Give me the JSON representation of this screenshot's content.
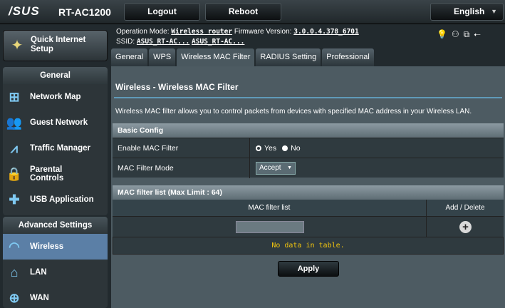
{
  "topbar": {
    "logo": "/SUS",
    "model": "RT-AC1200",
    "logout_label": "Logout",
    "reboot_label": "Reboot",
    "language": "English"
  },
  "sidebar": {
    "quick_setup": "Quick Internet Setup",
    "general_heading": "General",
    "general_items": [
      {
        "label": "Network Map",
        "icon": "network-map-icon"
      },
      {
        "label": "Guest Network",
        "icon": "guest-network-icon"
      },
      {
        "label": "Traffic Manager",
        "icon": "traffic-manager-icon"
      },
      {
        "label": "Parental Controls",
        "icon": "parental-controls-icon"
      },
      {
        "label": "USB Application",
        "icon": "usb-application-icon"
      }
    ],
    "advanced_heading": "Advanced Settings",
    "advanced_items": [
      {
        "label": "Wireless",
        "icon": "wireless-icon",
        "active": true
      },
      {
        "label": "LAN",
        "icon": "lan-icon"
      },
      {
        "label": "WAN",
        "icon": "wan-icon"
      }
    ]
  },
  "status": {
    "mode_label": "Operation Mode:",
    "mode_value": "Wireless router",
    "fw_label": "Firmware Version:",
    "fw_value": "3.0.0.4.378_6701",
    "ssid_label": "SSID:",
    "ssid_1": "ASUS_RT-AC...",
    "ssid_2": "ASUS_RT-AC..."
  },
  "tabs": [
    "General",
    "WPS",
    "Wireless MAC Filter",
    "RADIUS Setting",
    "Professional"
  ],
  "main": {
    "title": "Wireless - Wireless MAC Filter",
    "description": "Wireless MAC filter allows you to control packets from devices with specified MAC address in your Wireless LAN.",
    "basic_config": "Basic Config",
    "enable_label": "Enable MAC Filter",
    "yes_label": "Yes",
    "no_label": "No",
    "mode_label": "MAC Filter Mode",
    "mode_value": "Accept",
    "list_heading": "MAC filter list (Max Limit : 64)",
    "col_list": "MAC filter list",
    "col_add": "Add / Delete",
    "empty": "No data in table.",
    "apply_label": "Apply"
  },
  "colors": {
    "accent": "#5f9ab9",
    "active_nav": "#5b7fa6",
    "warning": "#f1c40f"
  }
}
